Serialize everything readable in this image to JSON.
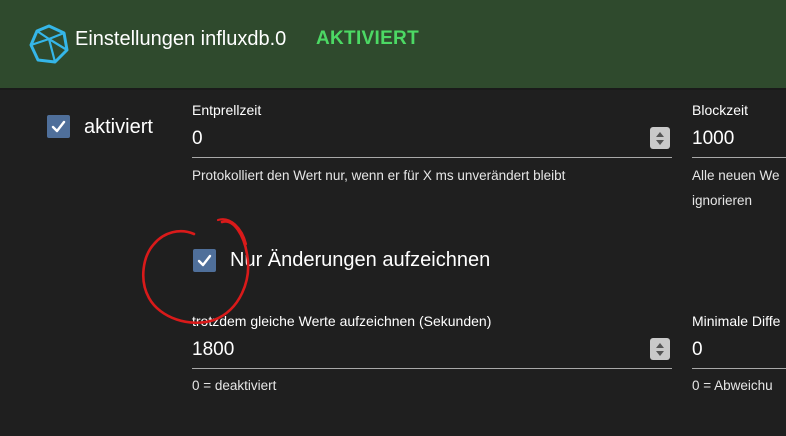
{
  "header": {
    "title": "Einstellungen influxdb.0",
    "status": "AKTIVIERT",
    "status_color": "#4cd964",
    "icon": "influxdb-icon"
  },
  "main": {
    "enabled": {
      "label": "aktiviert",
      "checked": true
    },
    "debounce": {
      "label": "Entprellzeit",
      "value": "0",
      "helper": "Protokolliert den Wert nur, wenn er für X ms unverändert bleibt"
    },
    "blocktime": {
      "label": "Blockzeit",
      "value": "1000",
      "helper_line1": "Alle neuen We",
      "helper_line2": "ignorieren"
    },
    "changes_only": {
      "label": "Nur Änderungen aufzeichnen",
      "checked": true
    },
    "changes_relog": {
      "label": "trotzdem gleiche Werte aufzeichnen (Sekunden)",
      "value": "1800",
      "helper": "0 = deaktiviert"
    },
    "min_difference": {
      "label": "Minimale Diffe",
      "value": "0",
      "helper": "0 = Abweichu"
    }
  },
  "annotation": {
    "color": "#d91a1a"
  }
}
